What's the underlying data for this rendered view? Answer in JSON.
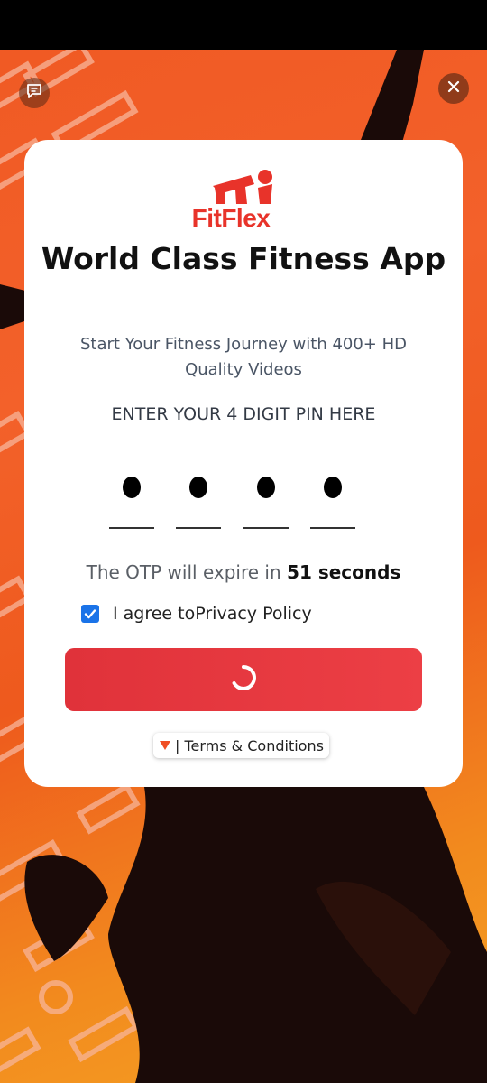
{
  "app": {
    "brand": "FitFlex",
    "title": "World Class Fitness App",
    "subtitle": "Start Your Fitness Journey with 400+ HD Quality Videos"
  },
  "pin": {
    "label": "ENTER YOUR 4 DIGIT PIN HERE",
    "digits_entered": 4,
    "digits_total": 4
  },
  "otp": {
    "prefix": "The OTP will expire in",
    "countdown": "51 seconds"
  },
  "agreement": {
    "checked": true,
    "label": "I agree toPrivacy Policy"
  },
  "submit": {
    "state": "loading"
  },
  "footer": {
    "terms_label": "| Terms & Conditions"
  },
  "icons": {
    "feedback": "feedback-icon",
    "close": "close-icon",
    "spinner": "spinner-icon",
    "triangle": "triangle-down-icon"
  },
  "colors": {
    "brand_red": "#e8332a",
    "button_red": "#e4363e",
    "background_orange": "#f05a24",
    "checkbox_blue": "#1a73e8"
  }
}
